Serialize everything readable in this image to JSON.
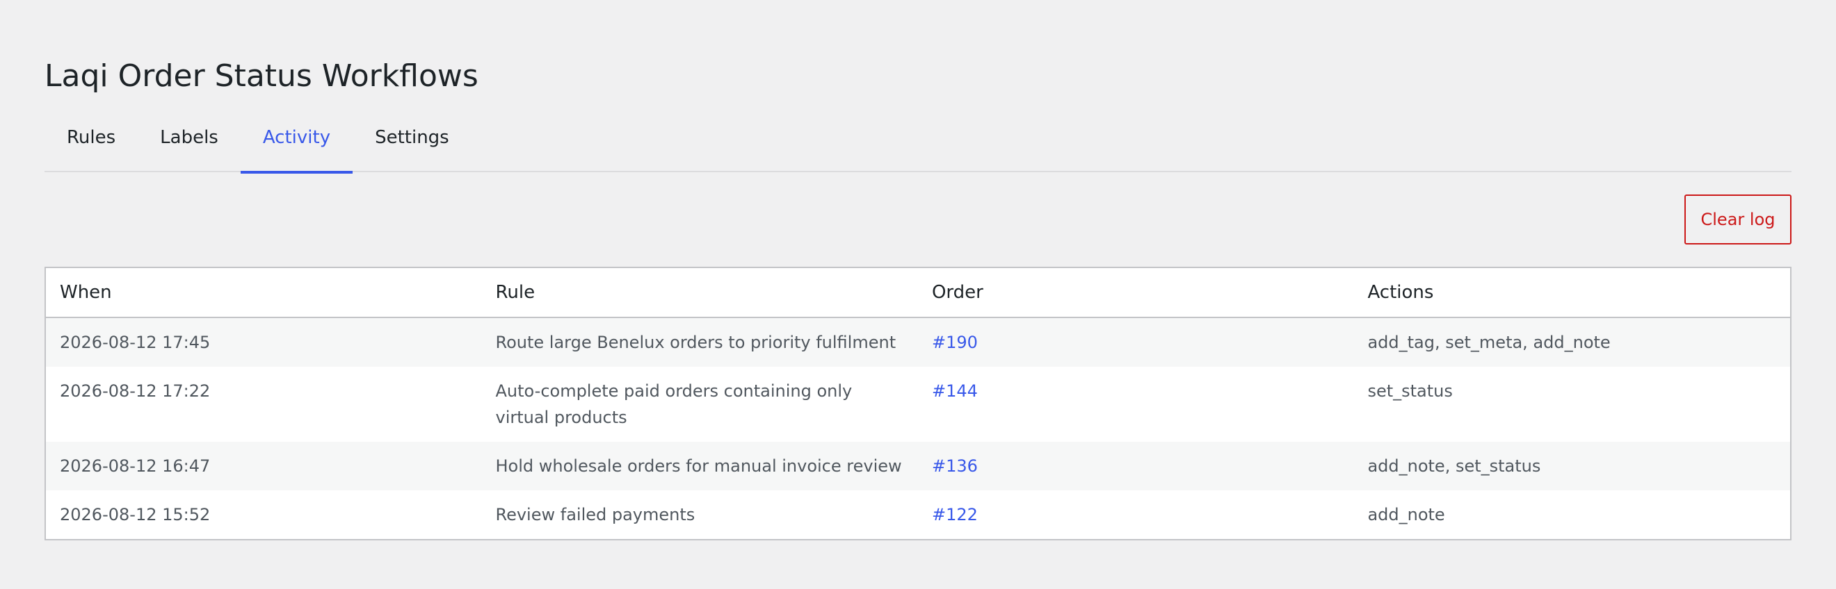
{
  "page": {
    "title": "Laqi Order Status Workflows"
  },
  "tabs": [
    {
      "label": "Rules",
      "active": false
    },
    {
      "label": "Labels",
      "active": false
    },
    {
      "label": "Activity",
      "active": true
    },
    {
      "label": "Settings",
      "active": false
    }
  ],
  "toolbar": {
    "clear_label": "Clear log"
  },
  "table": {
    "headers": [
      "When",
      "Rule",
      "Order",
      "Actions"
    ],
    "rows": [
      {
        "when": "2026-08-12 17:45",
        "rule": "Route large Benelux orders to priority fulfilment",
        "order": "#190",
        "actions": "add_tag, set_meta, add_note"
      },
      {
        "when": "2026-08-12 17:22",
        "rule": "Auto-complete paid orders containing only virtual products",
        "order": "#144",
        "actions": "set_status"
      },
      {
        "when": "2026-08-12 16:47",
        "rule": "Hold wholesale orders for manual invoice review",
        "order": "#136",
        "actions": "add_note, set_status"
      },
      {
        "when": "2026-08-12 15:52",
        "rule": "Review failed payments",
        "order": "#122",
        "actions": "add_note"
      }
    ]
  },
  "colors": {
    "accent": "#3858e9",
    "danger": "#cc1818",
    "background": "#f0f0f1"
  }
}
